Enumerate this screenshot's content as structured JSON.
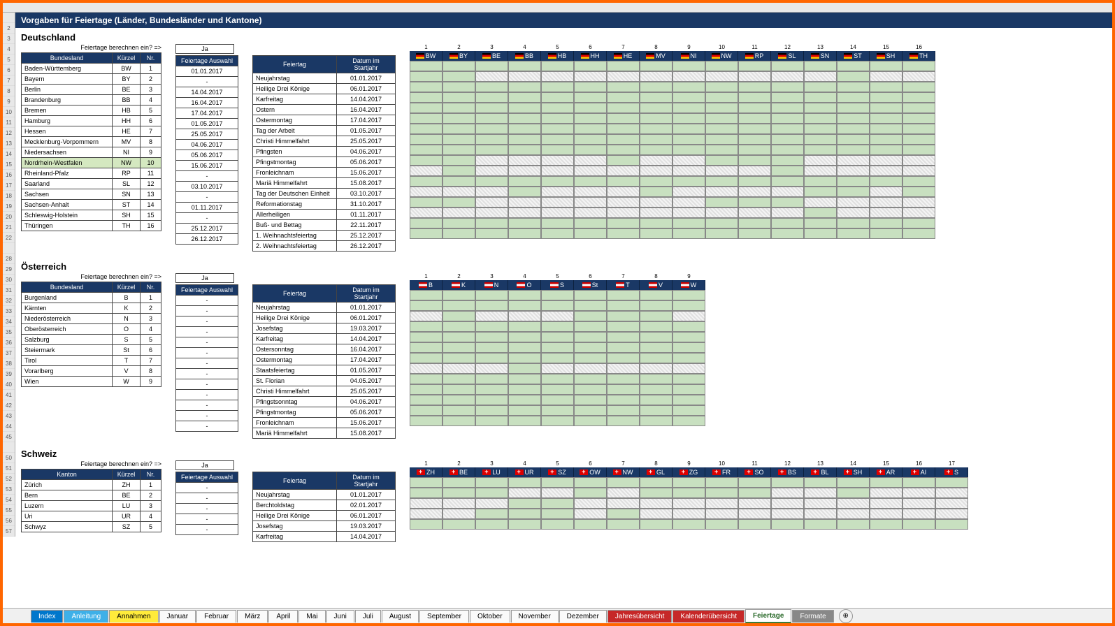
{
  "title": "Vorgaben für Feiertage  (Länder, Bundesländer und Kantone)",
  "prompt_label": "Feiertage berechnen ein? =>",
  "ja_label": "Ja",
  "headers": {
    "bundesland": "Bundesland",
    "kanton": "Kanton",
    "kuerzel": "Kürzel",
    "nr": "Nr.",
    "auswahl": "Feiertage Auswahl",
    "feiertag": "Feiertag",
    "datum": "Datum im Startjahr"
  },
  "deutschland": {
    "title": "Deutschland",
    "bundeslaender": [
      {
        "name": "Baden-Württemberg",
        "k": "BW",
        "nr": "1"
      },
      {
        "name": "Bayern",
        "k": "BY",
        "nr": "2"
      },
      {
        "name": "Berlin",
        "k": "BE",
        "nr": "3"
      },
      {
        "name": "Brandenburg",
        "k": "BB",
        "nr": "4"
      },
      {
        "name": "Bremen",
        "k": "HB",
        "nr": "5"
      },
      {
        "name": "Hamburg",
        "k": "HH",
        "nr": "6"
      },
      {
        "name": "Hessen",
        "k": "HE",
        "nr": "7"
      },
      {
        "name": "Mecklenburg-Vorpommern",
        "k": "MV",
        "nr": "8"
      },
      {
        "name": "Niedersachsen",
        "k": "NI",
        "nr": "9"
      },
      {
        "name": "Nordrhein-Westfalen",
        "k": "NW",
        "nr": "10",
        "hl": true
      },
      {
        "name": "Rheinland-Pfalz",
        "k": "RP",
        "nr": "11"
      },
      {
        "name": "Saarland",
        "k": "SL",
        "nr": "12"
      },
      {
        "name": "Sachsen",
        "k": "SN",
        "nr": "13"
      },
      {
        "name": "Sachsen-Anhalt",
        "k": "ST",
        "nr": "14"
      },
      {
        "name": "Schleswig-Holstein",
        "k": "SH",
        "nr": "15"
      },
      {
        "name": "Thüringen",
        "k": "TH",
        "nr": "16"
      }
    ],
    "auswahl": [
      "01.01.2017",
      "-",
      "14.04.2017",
      "16.04.2017",
      "17.04.2017",
      "01.05.2017",
      "25.05.2017",
      "04.06.2017",
      "05.06.2017",
      "15.06.2017",
      "-",
      "03.10.2017",
      "-",
      "01.11.2017",
      "-",
      "25.12.2017",
      "26.12.2017"
    ],
    "feiertage": [
      {
        "n": "Neujahrstag",
        "d": "01.01.2017"
      },
      {
        "n": "Heilige Drei Könige",
        "d": "06.01.2017"
      },
      {
        "n": "Karfreitag",
        "d": "14.04.2017"
      },
      {
        "n": "Ostern",
        "d": "16.04.2017"
      },
      {
        "n": "Ostermontag",
        "d": "17.04.2017"
      },
      {
        "n": "Tag der Arbeit",
        "d": "01.05.2017"
      },
      {
        "n": "Christi Himmelfahrt",
        "d": "25.05.2017"
      },
      {
        "n": "Pfingsten",
        "d": "04.06.2017"
      },
      {
        "n": "Pfingstmontag",
        "d": "05.06.2017"
      },
      {
        "n": "Fronleichnam",
        "d": "15.06.2017"
      },
      {
        "n": "Mariä Himmelfahrt",
        "d": "15.08.2017"
      },
      {
        "n": "Tag der Deutschen Einheit",
        "d": "03.10.2017"
      },
      {
        "n": "Reformationstag",
        "d": "31.10.2017"
      },
      {
        "n": "Allerheiligen",
        "d": "01.11.2017"
      },
      {
        "n": "Buß- und Bettag",
        "d": "22.11.2017"
      },
      {
        "n": "1. Weihnachtsfeiertag",
        "d": "25.12.2017"
      },
      {
        "n": "2. Weihnachtsfeiertag",
        "d": "26.12.2017"
      }
    ],
    "matrix_cols": [
      "BW",
      "BY",
      "BE",
      "BB",
      "HB",
      "HH",
      "HE",
      "MV",
      "NI",
      "NW",
      "RP",
      "SL",
      "SN",
      "ST",
      "SH",
      "TH"
    ],
    "matrix": [
      [
        1,
        1,
        1,
        1,
        1,
        1,
        1,
        1,
        1,
        1,
        1,
        1,
        1,
        1,
        1,
        1
      ],
      [
        1,
        1,
        0,
        0,
        0,
        0,
        0,
        0,
        0,
        0,
        0,
        0,
        0,
        1,
        0,
        0
      ],
      [
        1,
        1,
        1,
        1,
        1,
        1,
        1,
        1,
        1,
        1,
        1,
        1,
        1,
        1,
        1,
        1
      ],
      [
        1,
        1,
        1,
        1,
        1,
        1,
        1,
        1,
        1,
        1,
        1,
        1,
        1,
        1,
        1,
        1
      ],
      [
        1,
        1,
        1,
        1,
        1,
        1,
        1,
        1,
        1,
        1,
        1,
        1,
        1,
        1,
        1,
        1
      ],
      [
        1,
        1,
        1,
        1,
        1,
        1,
        1,
        1,
        1,
        1,
        1,
        1,
        1,
        1,
        1,
        1
      ],
      [
        1,
        1,
        1,
        1,
        1,
        1,
        1,
        1,
        1,
        1,
        1,
        1,
        1,
        1,
        1,
        1
      ],
      [
        1,
        1,
        1,
        1,
        1,
        1,
        1,
        1,
        1,
        1,
        1,
        1,
        1,
        1,
        1,
        1
      ],
      [
        1,
        1,
        1,
        1,
        1,
        1,
        1,
        1,
        1,
        1,
        1,
        1,
        1,
        1,
        1,
        1
      ],
      [
        1,
        1,
        0,
        0,
        0,
        0,
        1,
        0,
        0,
        1,
        1,
        1,
        0,
        0,
        0,
        0
      ],
      [
        0,
        1,
        0,
        0,
        0,
        0,
        0,
        0,
        0,
        0,
        0,
        1,
        0,
        0,
        0,
        0
      ],
      [
        1,
        1,
        1,
        1,
        1,
        1,
        1,
        1,
        1,
        1,
        1,
        1,
        1,
        1,
        1,
        1
      ],
      [
        0,
        0,
        0,
        1,
        0,
        0,
        0,
        1,
        0,
        0,
        0,
        0,
        1,
        1,
        0,
        1
      ],
      [
        1,
        1,
        0,
        0,
        0,
        0,
        0,
        0,
        0,
        1,
        1,
        1,
        0,
        0,
        0,
        0
      ],
      [
        0,
        0,
        0,
        0,
        0,
        0,
        0,
        0,
        0,
        0,
        0,
        0,
        1,
        0,
        0,
        0
      ],
      [
        1,
        1,
        1,
        1,
        1,
        1,
        1,
        1,
        1,
        1,
        1,
        1,
        1,
        1,
        1,
        1
      ],
      [
        1,
        1,
        1,
        1,
        1,
        1,
        1,
        1,
        1,
        1,
        1,
        1,
        1,
        1,
        1,
        1
      ]
    ]
  },
  "oesterreich": {
    "title": "Österreich",
    "bundeslaender": [
      {
        "name": "Burgenland",
        "k": "B",
        "nr": "1"
      },
      {
        "name": "Kärnten",
        "k": "K",
        "nr": "2"
      },
      {
        "name": "Niederösterreich",
        "k": "N",
        "nr": "3"
      },
      {
        "name": "Oberösterreich",
        "k": "O",
        "nr": "4"
      },
      {
        "name": "Salzburg",
        "k": "S",
        "nr": "5"
      },
      {
        "name": "Steiermark",
        "k": "St",
        "nr": "6"
      },
      {
        "name": "Tirol",
        "k": "T",
        "nr": "7"
      },
      {
        "name": "Vorarlberg",
        "k": "V",
        "nr": "8"
      },
      {
        "name": "Wien",
        "k": "W",
        "nr": "9"
      }
    ],
    "auswahl": [
      "-",
      "-",
      "-",
      "-",
      "-",
      "-",
      "-",
      "-",
      "-",
      "-",
      "-",
      "-",
      "-"
    ],
    "feiertage": [
      {
        "n": "Neujahrstag",
        "d": "01.01.2017"
      },
      {
        "n": "Heilige Drei Könige",
        "d": "06.01.2017"
      },
      {
        "n": "Josefstag",
        "d": "19.03.2017"
      },
      {
        "n": "Karfreitag",
        "d": "14.04.2017"
      },
      {
        "n": "Ostersonntag",
        "d": "16.04.2017"
      },
      {
        "n": "Ostermontag",
        "d": "17.04.2017"
      },
      {
        "n": "Staatsfeiertag",
        "d": "01.05.2017"
      },
      {
        "n": "St. Florian",
        "d": "04.05.2017"
      },
      {
        "n": "Christi Himmelfahrt",
        "d": "25.05.2017"
      },
      {
        "n": "Pfingstsonntag",
        "d": "04.06.2017"
      },
      {
        "n": "Pfingstmontag",
        "d": "05.06.2017"
      },
      {
        "n": "Fronleichnam",
        "d": "15.06.2017"
      },
      {
        "n": "Mariä Himmelfahrt",
        "d": "15.08.2017"
      }
    ],
    "matrix_cols": [
      "B",
      "K",
      "N",
      "O",
      "S",
      "St",
      "T",
      "V",
      "W"
    ],
    "matrix": [
      [
        1,
        1,
        1,
        1,
        1,
        1,
        1,
        1,
        1
      ],
      [
        1,
        1,
        1,
        1,
        1,
        1,
        1,
        1,
        1
      ],
      [
        0,
        1,
        0,
        0,
        0,
        1,
        1,
        1,
        0
      ],
      [
        1,
        1,
        1,
        1,
        1,
        1,
        1,
        1,
        1
      ],
      [
        1,
        1,
        1,
        1,
        1,
        1,
        1,
        1,
        1
      ],
      [
        1,
        1,
        1,
        1,
        1,
        1,
        1,
        1,
        1
      ],
      [
        1,
        1,
        1,
        1,
        1,
        1,
        1,
        1,
        1
      ],
      [
        0,
        0,
        0,
        1,
        0,
        0,
        0,
        0,
        0
      ],
      [
        1,
        1,
        1,
        1,
        1,
        1,
        1,
        1,
        1
      ],
      [
        1,
        1,
        1,
        1,
        1,
        1,
        1,
        1,
        1
      ],
      [
        1,
        1,
        1,
        1,
        1,
        1,
        1,
        1,
        1
      ],
      [
        1,
        1,
        1,
        1,
        1,
        1,
        1,
        1,
        1
      ],
      [
        1,
        1,
        1,
        1,
        1,
        1,
        1,
        1,
        1
      ]
    ]
  },
  "schweiz": {
    "title": "Schweiz",
    "kantone": [
      {
        "name": "Zürich",
        "k": "ZH",
        "nr": "1"
      },
      {
        "name": "Bern",
        "k": "BE",
        "nr": "2"
      },
      {
        "name": "Luzern",
        "k": "LU",
        "nr": "3"
      },
      {
        "name": "Uri",
        "k": "UR",
        "nr": "4"
      },
      {
        "name": "Schwyz",
        "k": "SZ",
        "nr": "5"
      }
    ],
    "auswahl": [
      "-",
      "-",
      "-",
      "-",
      "-"
    ],
    "feiertage": [
      {
        "n": "Neujahrstag",
        "d": "01.01.2017"
      },
      {
        "n": "Berchtoldstag",
        "d": "02.01.2017"
      },
      {
        "n": "Heilige Drei Könige",
        "d": "06.01.2017"
      },
      {
        "n": "Josefstag",
        "d": "19.03.2017"
      },
      {
        "n": "Karfreitag",
        "d": "14.04.2017"
      }
    ],
    "matrix_cols": [
      "ZH",
      "BE",
      "LU",
      "UR",
      "SZ",
      "OW",
      "NW",
      "GL",
      "ZG",
      "FR",
      "SO",
      "BS",
      "BL",
      "SH",
      "AR",
      "AI",
      "S"
    ],
    "matrix": [
      [
        1,
        1,
        1,
        1,
        1,
        1,
        1,
        1,
        1,
        1,
        1,
        1,
        1,
        1,
        1,
        1,
        1
      ],
      [
        1,
        1,
        1,
        0,
        0,
        1,
        0,
        1,
        1,
        1,
        1,
        0,
        0,
        1,
        0,
        0,
        0
      ],
      [
        0,
        0,
        0,
        1,
        1,
        0,
        0,
        0,
        0,
        0,
        0,
        0,
        0,
        0,
        0,
        0,
        0
      ],
      [
        0,
        0,
        1,
        1,
        1,
        0,
        1,
        0,
        0,
        0,
        0,
        0,
        0,
        0,
        0,
        0,
        0
      ],
      [
        1,
        1,
        1,
        1,
        1,
        1,
        1,
        1,
        1,
        1,
        1,
        1,
        1,
        1,
        1,
        1,
        1
      ]
    ]
  },
  "tabs": [
    {
      "label": "Index",
      "cls": "blue"
    },
    {
      "label": "Anleitung",
      "cls": "lblue"
    },
    {
      "label": "Annahmen",
      "cls": "yellow"
    },
    {
      "label": "Januar",
      "cls": ""
    },
    {
      "label": "Februar",
      "cls": ""
    },
    {
      "label": "März",
      "cls": ""
    },
    {
      "label": "April",
      "cls": ""
    },
    {
      "label": "Mai",
      "cls": ""
    },
    {
      "label": "Juni",
      "cls": ""
    },
    {
      "label": "Juli",
      "cls": ""
    },
    {
      "label": "August",
      "cls": ""
    },
    {
      "label": "September",
      "cls": ""
    },
    {
      "label": "Oktober",
      "cls": ""
    },
    {
      "label": "November",
      "cls": ""
    },
    {
      "label": "Dezember",
      "cls": ""
    },
    {
      "label": "Jahresübersicht",
      "cls": "red"
    },
    {
      "label": "Kalenderübersicht",
      "cls": "red"
    },
    {
      "label": "Feiertage",
      "cls": "active"
    },
    {
      "label": "Formate",
      "cls": "grey"
    }
  ],
  "row_numbers": [
    "",
    "2",
    "3",
    "4",
    "5",
    "6",
    "7",
    "8",
    "9",
    "10",
    "11",
    "12",
    "13",
    "14",
    "15",
    "16",
    "17",
    "18",
    "19",
    "20",
    "21",
    "22",
    "",
    "28",
    "29",
    "30",
    "31",
    "32",
    "33",
    "34",
    "35",
    "36",
    "37",
    "38",
    "39",
    "40",
    "41",
    "42",
    "43",
    "44",
    "45",
    "",
    "50",
    "51",
    "52",
    "53",
    "54",
    "55",
    "56",
    "57"
  ]
}
